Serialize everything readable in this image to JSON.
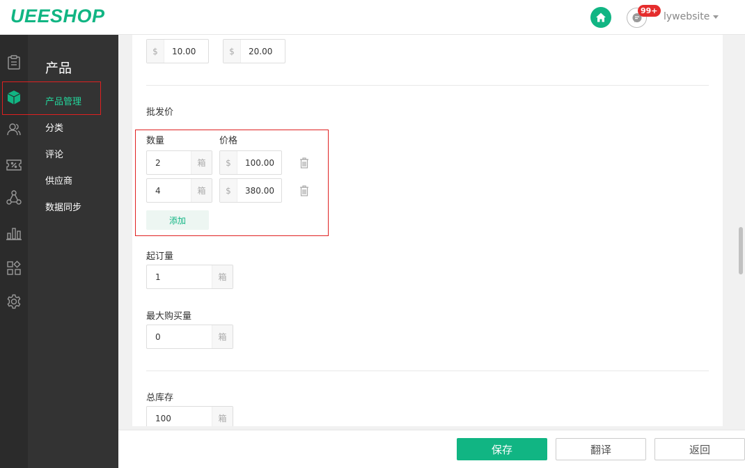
{
  "header": {
    "logo": "UEESHOP",
    "badge": "99+",
    "username": "lywebsite",
    "icons": [
      "home-icon",
      "message-icon"
    ]
  },
  "colors": {
    "accent": "#11b583",
    "highlight": "#e02020",
    "sidebar": "#2b2b2b",
    "submenu": "#333333"
  },
  "iconbar": [
    "orders-icon",
    "product-icon",
    "users-icon",
    "discount-icon",
    "share-icon",
    "stats-icon",
    "apps-icon",
    "settings-icon"
  ],
  "submenu": {
    "title": "产品",
    "items": [
      {
        "label": "产品管理"
      },
      {
        "label": "分类"
      },
      {
        "label": "评论"
      },
      {
        "label": "供应商"
      },
      {
        "label": "数据同步"
      }
    ]
  },
  "form": {
    "prices": [
      {
        "currency": "$",
        "value": "10.00"
      },
      {
        "currency": "$",
        "value": "20.00"
      }
    ],
    "wholesale": {
      "label": "批发价",
      "qty_header": "数量",
      "price_header": "价格",
      "rows": [
        {
          "qty": "2",
          "unit": "箱",
          "currency": "$",
          "price": "100.00"
        },
        {
          "qty": "4",
          "unit": "箱",
          "currency": "$",
          "price": "380.00"
        }
      ],
      "add_label": "添加"
    },
    "moq": {
      "label": "起订量",
      "value": "1",
      "unit": "箱"
    },
    "max_qty": {
      "label": "最大购买量",
      "value": "0",
      "unit": "箱"
    },
    "stock": {
      "label": "总库存",
      "value": "100",
      "unit": "箱"
    }
  },
  "footer": {
    "save": "保存",
    "translate": "翻译",
    "back": "返回"
  }
}
